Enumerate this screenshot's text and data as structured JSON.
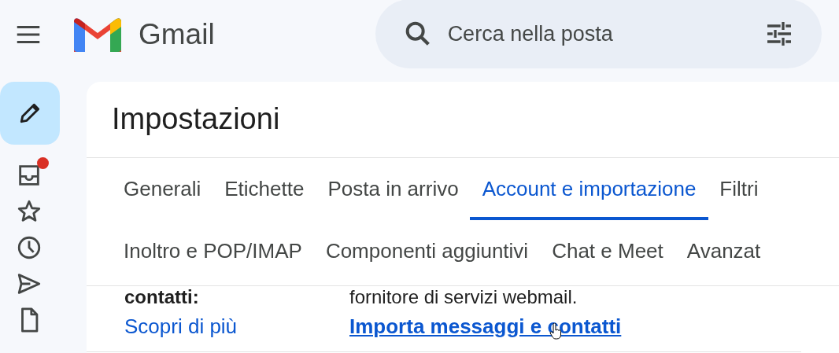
{
  "app": {
    "name": "Gmail"
  },
  "search": {
    "placeholder": "Cerca nella posta"
  },
  "rail": [
    {
      "kind": "inbox",
      "unread": true
    },
    {
      "kind": "star",
      "unread": false
    },
    {
      "kind": "clock",
      "unread": false
    },
    {
      "kind": "send",
      "unread": false
    },
    {
      "kind": "file",
      "unread": false
    }
  ],
  "settings": {
    "title": "Impostazioni",
    "tab_rows": [
      [
        {
          "label": "Generali",
          "selected": false
        },
        {
          "label": "Etichette",
          "selected": false
        },
        {
          "label": "Posta in arrivo",
          "selected": false
        },
        {
          "label": "Account e importazione",
          "selected": true
        },
        {
          "label": "Filtri",
          "selected": false
        }
      ],
      [
        {
          "label": "Inoltro e POP/IMAP",
          "selected": false
        },
        {
          "label": "Componenti aggiuntivi",
          "selected": false
        },
        {
          "label": "Chat e Meet",
          "selected": false
        },
        {
          "label": "Avanzat",
          "selected": false
        }
      ]
    ],
    "section": {
      "label": "contatti:",
      "label_link": "Scopri di più",
      "description": "fornitore di servizi webmail.",
      "action_link": "Importa messaggi e contatti"
    }
  }
}
